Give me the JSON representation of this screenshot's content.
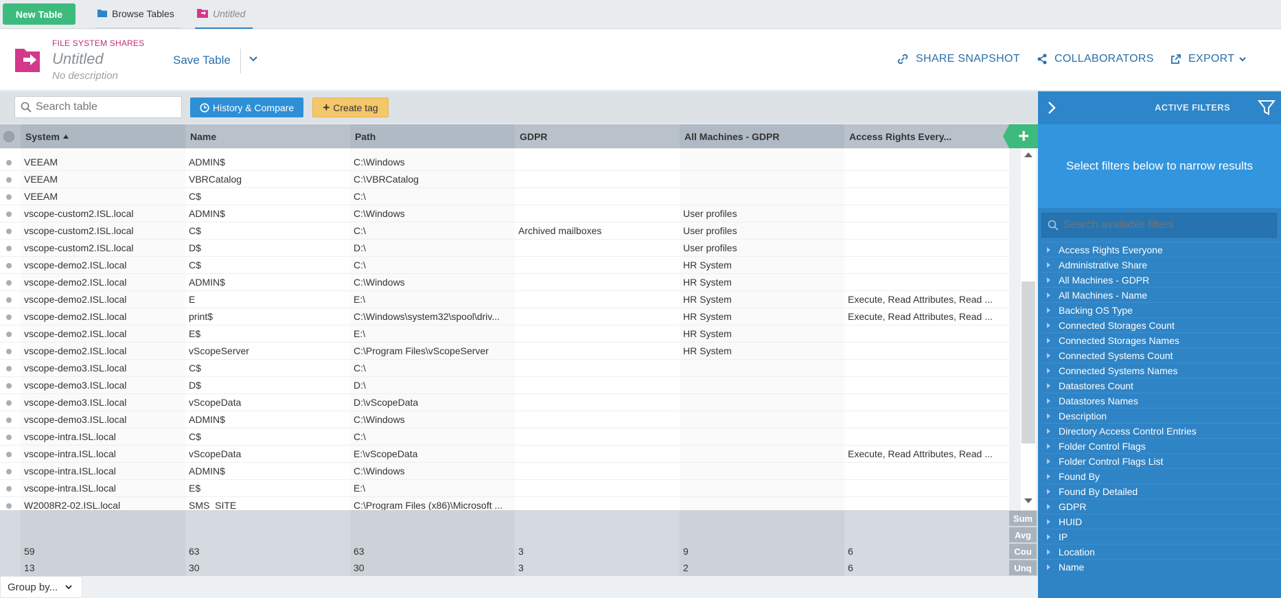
{
  "topbar": {
    "new_table_label": "New Table",
    "browse_tab_label": "Browse Tables",
    "untitled_tab_label": "Untitled"
  },
  "header": {
    "type_label": "FILE SYSTEM SHARES",
    "title": "Untitled",
    "description": "No description",
    "save_label": "Save Table",
    "share_label": "SHARE SNAPSHOT",
    "collab_label": "COLLABORATORS",
    "export_label": "EXPORT"
  },
  "toolbar": {
    "search_placeholder": "Search table",
    "history_label": "History & Compare",
    "tag_label": "Create tag"
  },
  "columns": [
    "System",
    "Name",
    "Path",
    "GDPR",
    "All Machines - GDPR",
    "Access Rights Every..."
  ],
  "rows": [
    [
      "VEEAM",
      "ADMIN$",
      "C:\\Windows",
      "",
      "",
      ""
    ],
    [
      "VEEAM",
      "VBRCatalog",
      "C:\\VBRCatalog",
      "",
      "",
      ""
    ],
    [
      "VEEAM",
      "C$",
      "C:\\",
      "",
      "",
      ""
    ],
    [
      "vscope-custom2.ISL.local",
      "ADMIN$",
      "C:\\Windows",
      "",
      "User profiles",
      ""
    ],
    [
      "vscope-custom2.ISL.local",
      "C$",
      "C:\\",
      "Archived mailboxes",
      "User profiles",
      ""
    ],
    [
      "vscope-custom2.ISL.local",
      "D$",
      "D:\\",
      "",
      "User profiles",
      ""
    ],
    [
      "vscope-demo2.ISL.local",
      "C$",
      "C:\\",
      "",
      "HR System",
      ""
    ],
    [
      "vscope-demo2.ISL.local",
      "ADMIN$",
      "C:\\Windows",
      "",
      "HR System",
      ""
    ],
    [
      "vscope-demo2.ISL.local",
      "E",
      "E:\\",
      "",
      "HR System",
      "Execute, Read Attributes, Read ..."
    ],
    [
      "vscope-demo2.ISL.local",
      "print$",
      "C:\\Windows\\system32\\spool\\driv...",
      "",
      "HR System",
      "Execute, Read Attributes, Read ..."
    ],
    [
      "vscope-demo2.ISL.local",
      "E$",
      "E:\\",
      "",
      "HR System",
      ""
    ],
    [
      "vscope-demo2.ISL.local",
      "vScopeServer",
      "C:\\Program Files\\vScopeServer",
      "",
      "HR System",
      ""
    ],
    [
      "vscope-demo3.ISL.local",
      "C$",
      "C:\\",
      "",
      "",
      ""
    ],
    [
      "vscope-demo3.ISL.local",
      "D$",
      "D:\\",
      "",
      "",
      ""
    ],
    [
      "vscope-demo3.ISL.local",
      "vScopeData",
      "D:\\vScopeData",
      "",
      "",
      ""
    ],
    [
      "vscope-demo3.ISL.local",
      "ADMIN$",
      "C:\\Windows",
      "",
      "",
      ""
    ],
    [
      "vscope-intra.ISL.local",
      "C$",
      "C:\\",
      "",
      "",
      ""
    ],
    [
      "vscope-intra.ISL.local",
      "vScopeData",
      "E:\\vScopeData",
      "",
      "",
      "Execute, Read Attributes, Read ..."
    ],
    [
      "vscope-intra.ISL.local",
      "ADMIN$",
      "C:\\Windows",
      "",
      "",
      ""
    ],
    [
      "vscope-intra.ISL.local",
      "E$",
      "E:\\",
      "",
      "",
      ""
    ],
    [
      "W2008R2-02.ISL.local",
      "SMS_SITE",
      "C:\\Program Files (x86)\\Microsoft ...",
      "",
      "",
      ""
    ]
  ],
  "footer": {
    "labels": [
      "Sum",
      "Avg",
      "Cou",
      "Unq"
    ],
    "count": [
      "59",
      "63",
      "63",
      "3",
      "9",
      "6"
    ],
    "unique": [
      "13",
      "30",
      "30",
      "3",
      "2",
      "6"
    ]
  },
  "group_by_label": "Group by...",
  "filters": {
    "title": "ACTIVE FILTERS",
    "message": "Select filters below to narrow results",
    "search_placeholder": "Search available filters",
    "items": [
      "Access Rights Everyone",
      "Administrative Share",
      "All Machines - GDPR",
      "All Machines - Name",
      "Backing OS Type",
      "Connected Storages Count",
      "Connected Storages Names",
      "Connected Systems Count",
      "Connected Systems Names",
      "Datastores Count",
      "Datastores Names",
      "Description",
      "Directory Access Control Entries",
      "Folder Control Flags",
      "Folder Control Flags List",
      "Found By",
      "Found By Detailed",
      "GDPR",
      "HUID",
      "IP",
      "Location",
      "Name"
    ]
  },
  "colors": {
    "accent_green": "#3dbb7e",
    "accent_blue": "#2d8fd6",
    "brand_pink": "#c0307a",
    "tag_yellow": "#f4c76a",
    "panel_blue": "#2f84c5"
  }
}
